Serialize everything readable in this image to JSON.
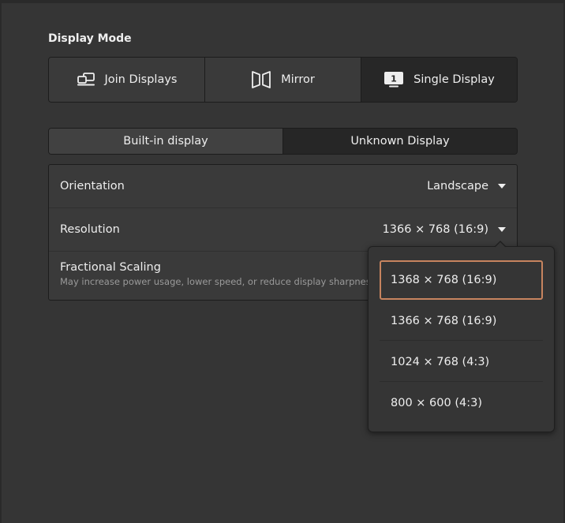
{
  "display_mode": {
    "title": "Display Mode",
    "options": [
      {
        "label": "Join Displays",
        "icon": "join-displays-icon",
        "active": false
      },
      {
        "label": "Mirror",
        "icon": "mirror-icon",
        "active": false
      },
      {
        "label": "Single Display",
        "icon": "single-display-icon",
        "active": true
      }
    ]
  },
  "display_tabs": [
    {
      "label": "Built-in display",
      "active": false
    },
    {
      "label": "Unknown Display",
      "active": true
    }
  ],
  "settings": {
    "orientation": {
      "label": "Orientation",
      "value": "Landscape"
    },
    "resolution": {
      "label": "Resolution",
      "value": "1366 × 768 (16:9)"
    },
    "fractional_scaling": {
      "label": "Fractional Scaling",
      "subtitle": "May increase power usage, lower speed, or reduce display sharpness."
    }
  },
  "resolution_popover": {
    "options": [
      "1368 × 768 (16:9)",
      "1366 × 768 (16:9)",
      "1024 × 768 (4:3)",
      "800 × 600 (4:3)"
    ],
    "highlighted_index": 0
  },
  "colors": {
    "background": "#353535",
    "active_segment": "#272727",
    "focus_outline": "#c7845f"
  }
}
